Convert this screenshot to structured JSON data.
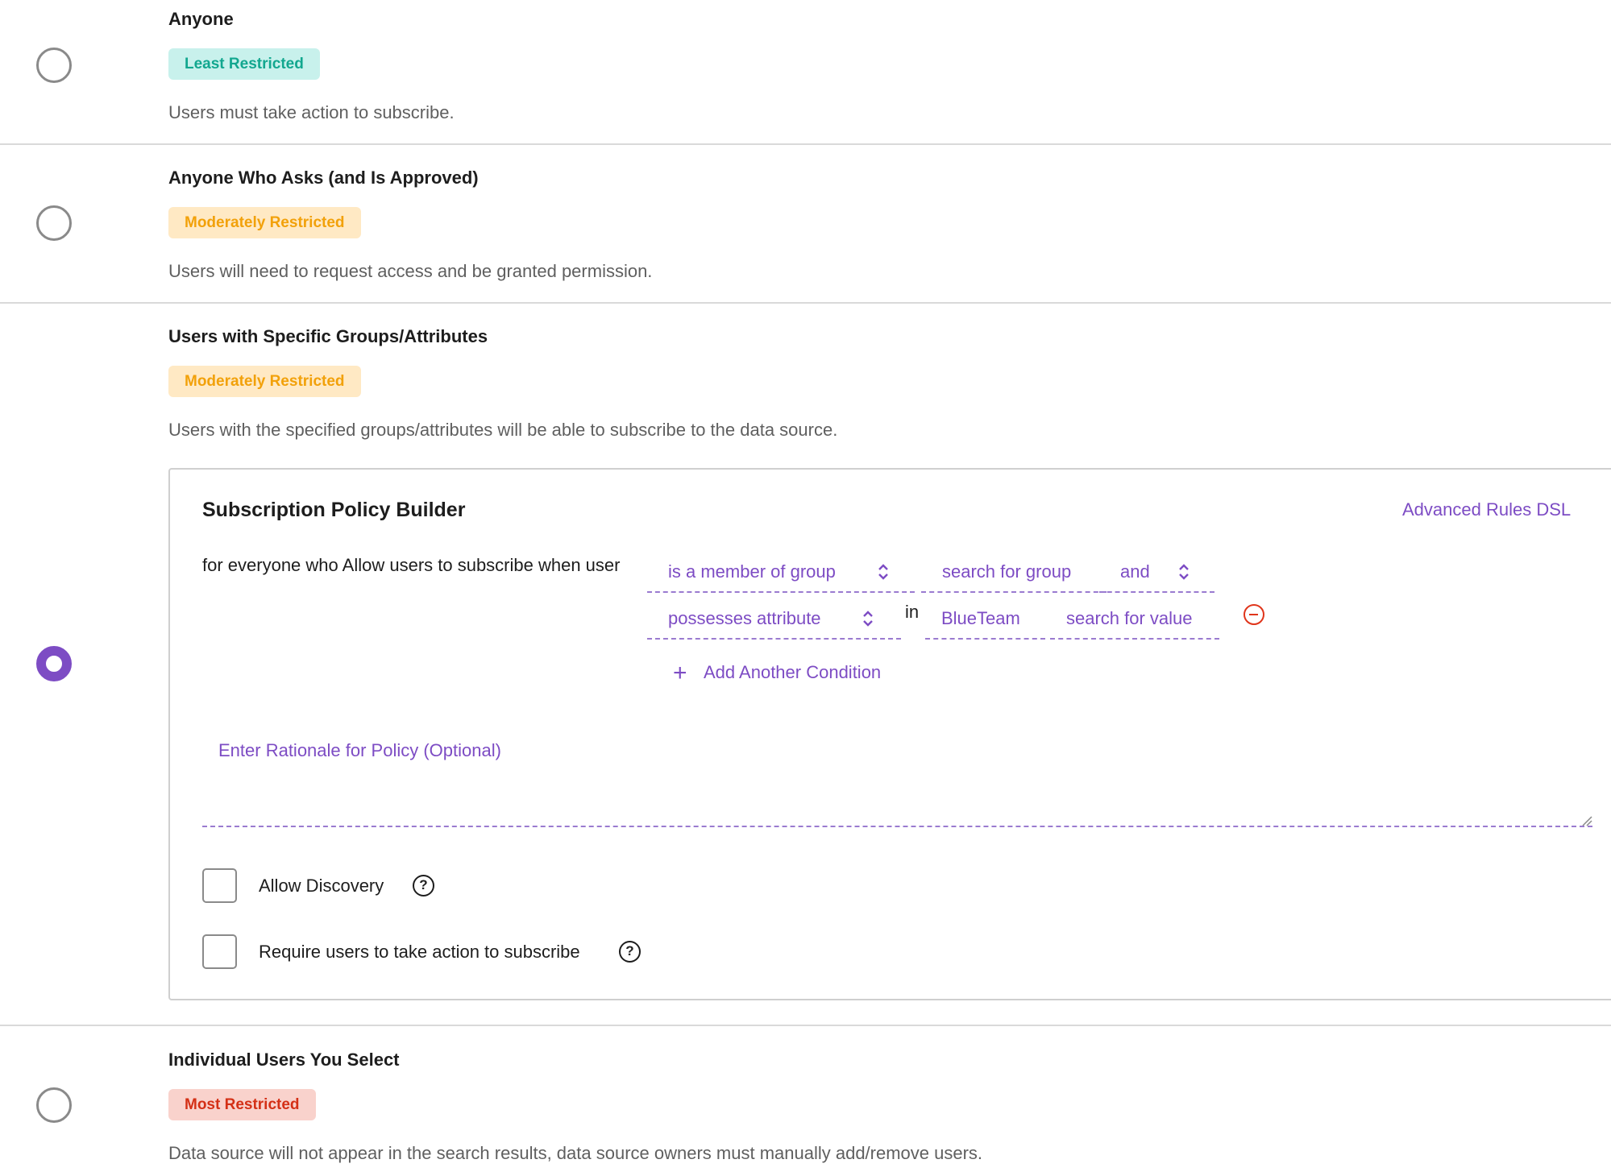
{
  "options": [
    {
      "title": "Anyone",
      "badge": "Least Restricted",
      "description": "Users must take action to subscribe.",
      "selected": false
    },
    {
      "title": "Anyone Who Asks (and Is Approved)",
      "badge": "Moderately Restricted",
      "description": "Users will need to request access and be granted permission.",
      "selected": false
    },
    {
      "title": "Users with Specific Groups/Attributes",
      "badge": "Moderately Restricted",
      "description": "Users with the specified groups/attributes will be able to subscribe to the data source.",
      "selected": true
    },
    {
      "title": "Individual Users You Select",
      "badge": "Most Restricted",
      "description": "Data source will not appear in the search results, data source owners must manually add/remove users.",
      "selected": false
    }
  ],
  "builder": {
    "title": "Subscription Policy Builder",
    "advanced_link": "Advanced Rules DSL",
    "lead_text": "for everyone who Allow users to subscribe when user",
    "condition1": {
      "operator": "is a member of group",
      "value_placeholder": "search for group",
      "conjunction": "and"
    },
    "condition2": {
      "operator": "possesses attribute",
      "in_label": "in",
      "attribute": "BlueTeam",
      "value_placeholder": "search for value"
    },
    "add_condition": "Add Another Condition",
    "rationale_placeholder": "Enter Rationale for Policy (Optional)",
    "allow_discovery": "Allow Discovery",
    "require_action": "Require users to take action to subscribe",
    "help_glyph": "?"
  },
  "colors": {
    "accent": "#7d4cc4",
    "least": "#12a78f",
    "moderate": "#f2a10a",
    "most": "#d43016",
    "remove": "#e0351b"
  }
}
